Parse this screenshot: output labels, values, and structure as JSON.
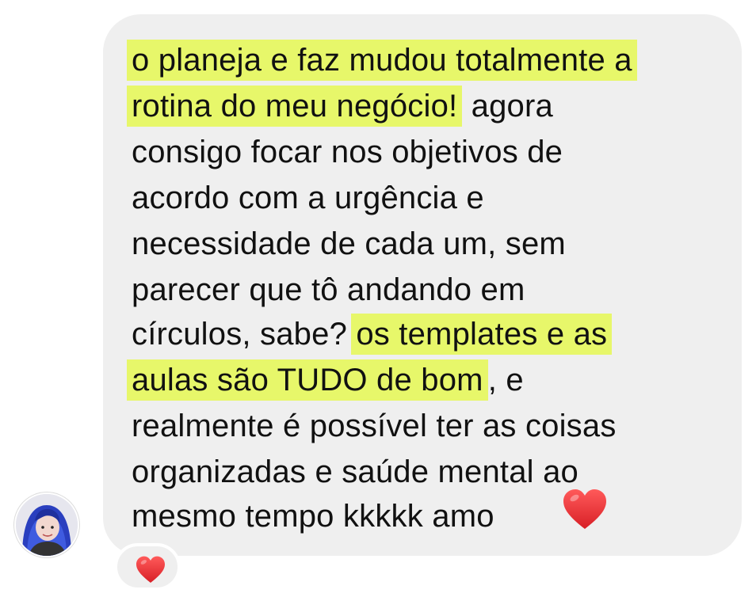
{
  "message": {
    "lines": [
      {
        "text": "",
        "highlight": "o planeja e faz mudou totalmente a",
        "after": ""
      },
      {
        "text": "",
        "highlight": "rotina do meu negócio!",
        "after": " agora"
      },
      {
        "text": "consigo focar nos objetivos de"
      },
      {
        "text": "acordo com a urgência e"
      },
      {
        "text": "necessidade de cada um, sem"
      },
      {
        "text": "parecer que tô andando em"
      },
      {
        "text": "círculos, sabe? ",
        "highlight": "os templates e as",
        "after": ""
      },
      {
        "text": "",
        "highlight": "aulas são TUDO de bom",
        "after": ", e"
      },
      {
        "text": "realmente é possível ter as coisas"
      },
      {
        "text": "organizadas e saúde mental ao"
      },
      {
        "text": "mesmo tempo kkkkk amo"
      }
    ],
    "inline_emoji": "heart-icon"
  },
  "reaction": {
    "emoji": "heart-icon"
  },
  "sender": {
    "avatar": "avatar"
  },
  "colors": {
    "bubble": "#efefef",
    "highlight": "#e7f76a",
    "heart": "#e02b2b",
    "text": "#111111"
  }
}
